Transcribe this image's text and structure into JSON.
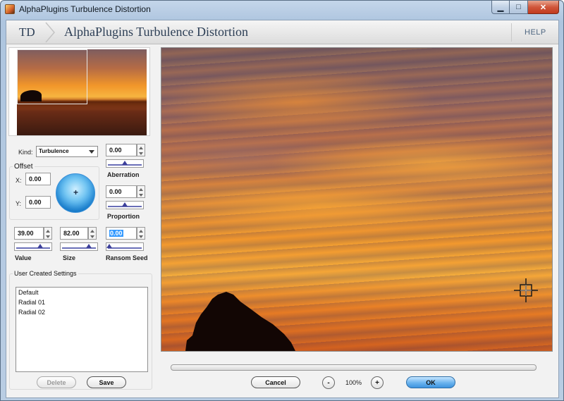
{
  "window": {
    "title": "AlphaPlugins Turbulence Distortion",
    "caption": {
      "minimize": "▁",
      "maximize": "□",
      "close": "✕"
    }
  },
  "banner": {
    "logo": "TD",
    "title": "AlphaPlugins Turbulence Distortion",
    "help": "HELP"
  },
  "controls": {
    "kind_label": "Kind:",
    "kind_value": "Turbulence",
    "offset_label": "Offset",
    "x_label": "X:",
    "x_value": "0.00",
    "y_label": "Y:",
    "y_value": "0.00",
    "aberration": {
      "label": "Aberration",
      "value": "0.00",
      "level": 0.5
    },
    "proportion": {
      "label": "Proportion",
      "value": "0.00",
      "level": 0.5
    },
    "value": {
      "label": "Value",
      "value": "39.00",
      "level": 0.72
    },
    "size": {
      "label": "Size",
      "value": "82.00",
      "level": 0.82
    },
    "seed": {
      "label": "Ransom Seed",
      "value": "0.00",
      "level": 0.0
    }
  },
  "settings": {
    "title": "User Created Settings",
    "items": [
      "Default",
      "Radial 01",
      "Radial 02"
    ],
    "delete_label": "Delete",
    "save_label": "Save"
  },
  "footer": {
    "cancel_label": "Cancel",
    "zoom_out": "-",
    "zoom_value": "100%",
    "zoom_in": "+",
    "ok_label": "OK"
  }
}
